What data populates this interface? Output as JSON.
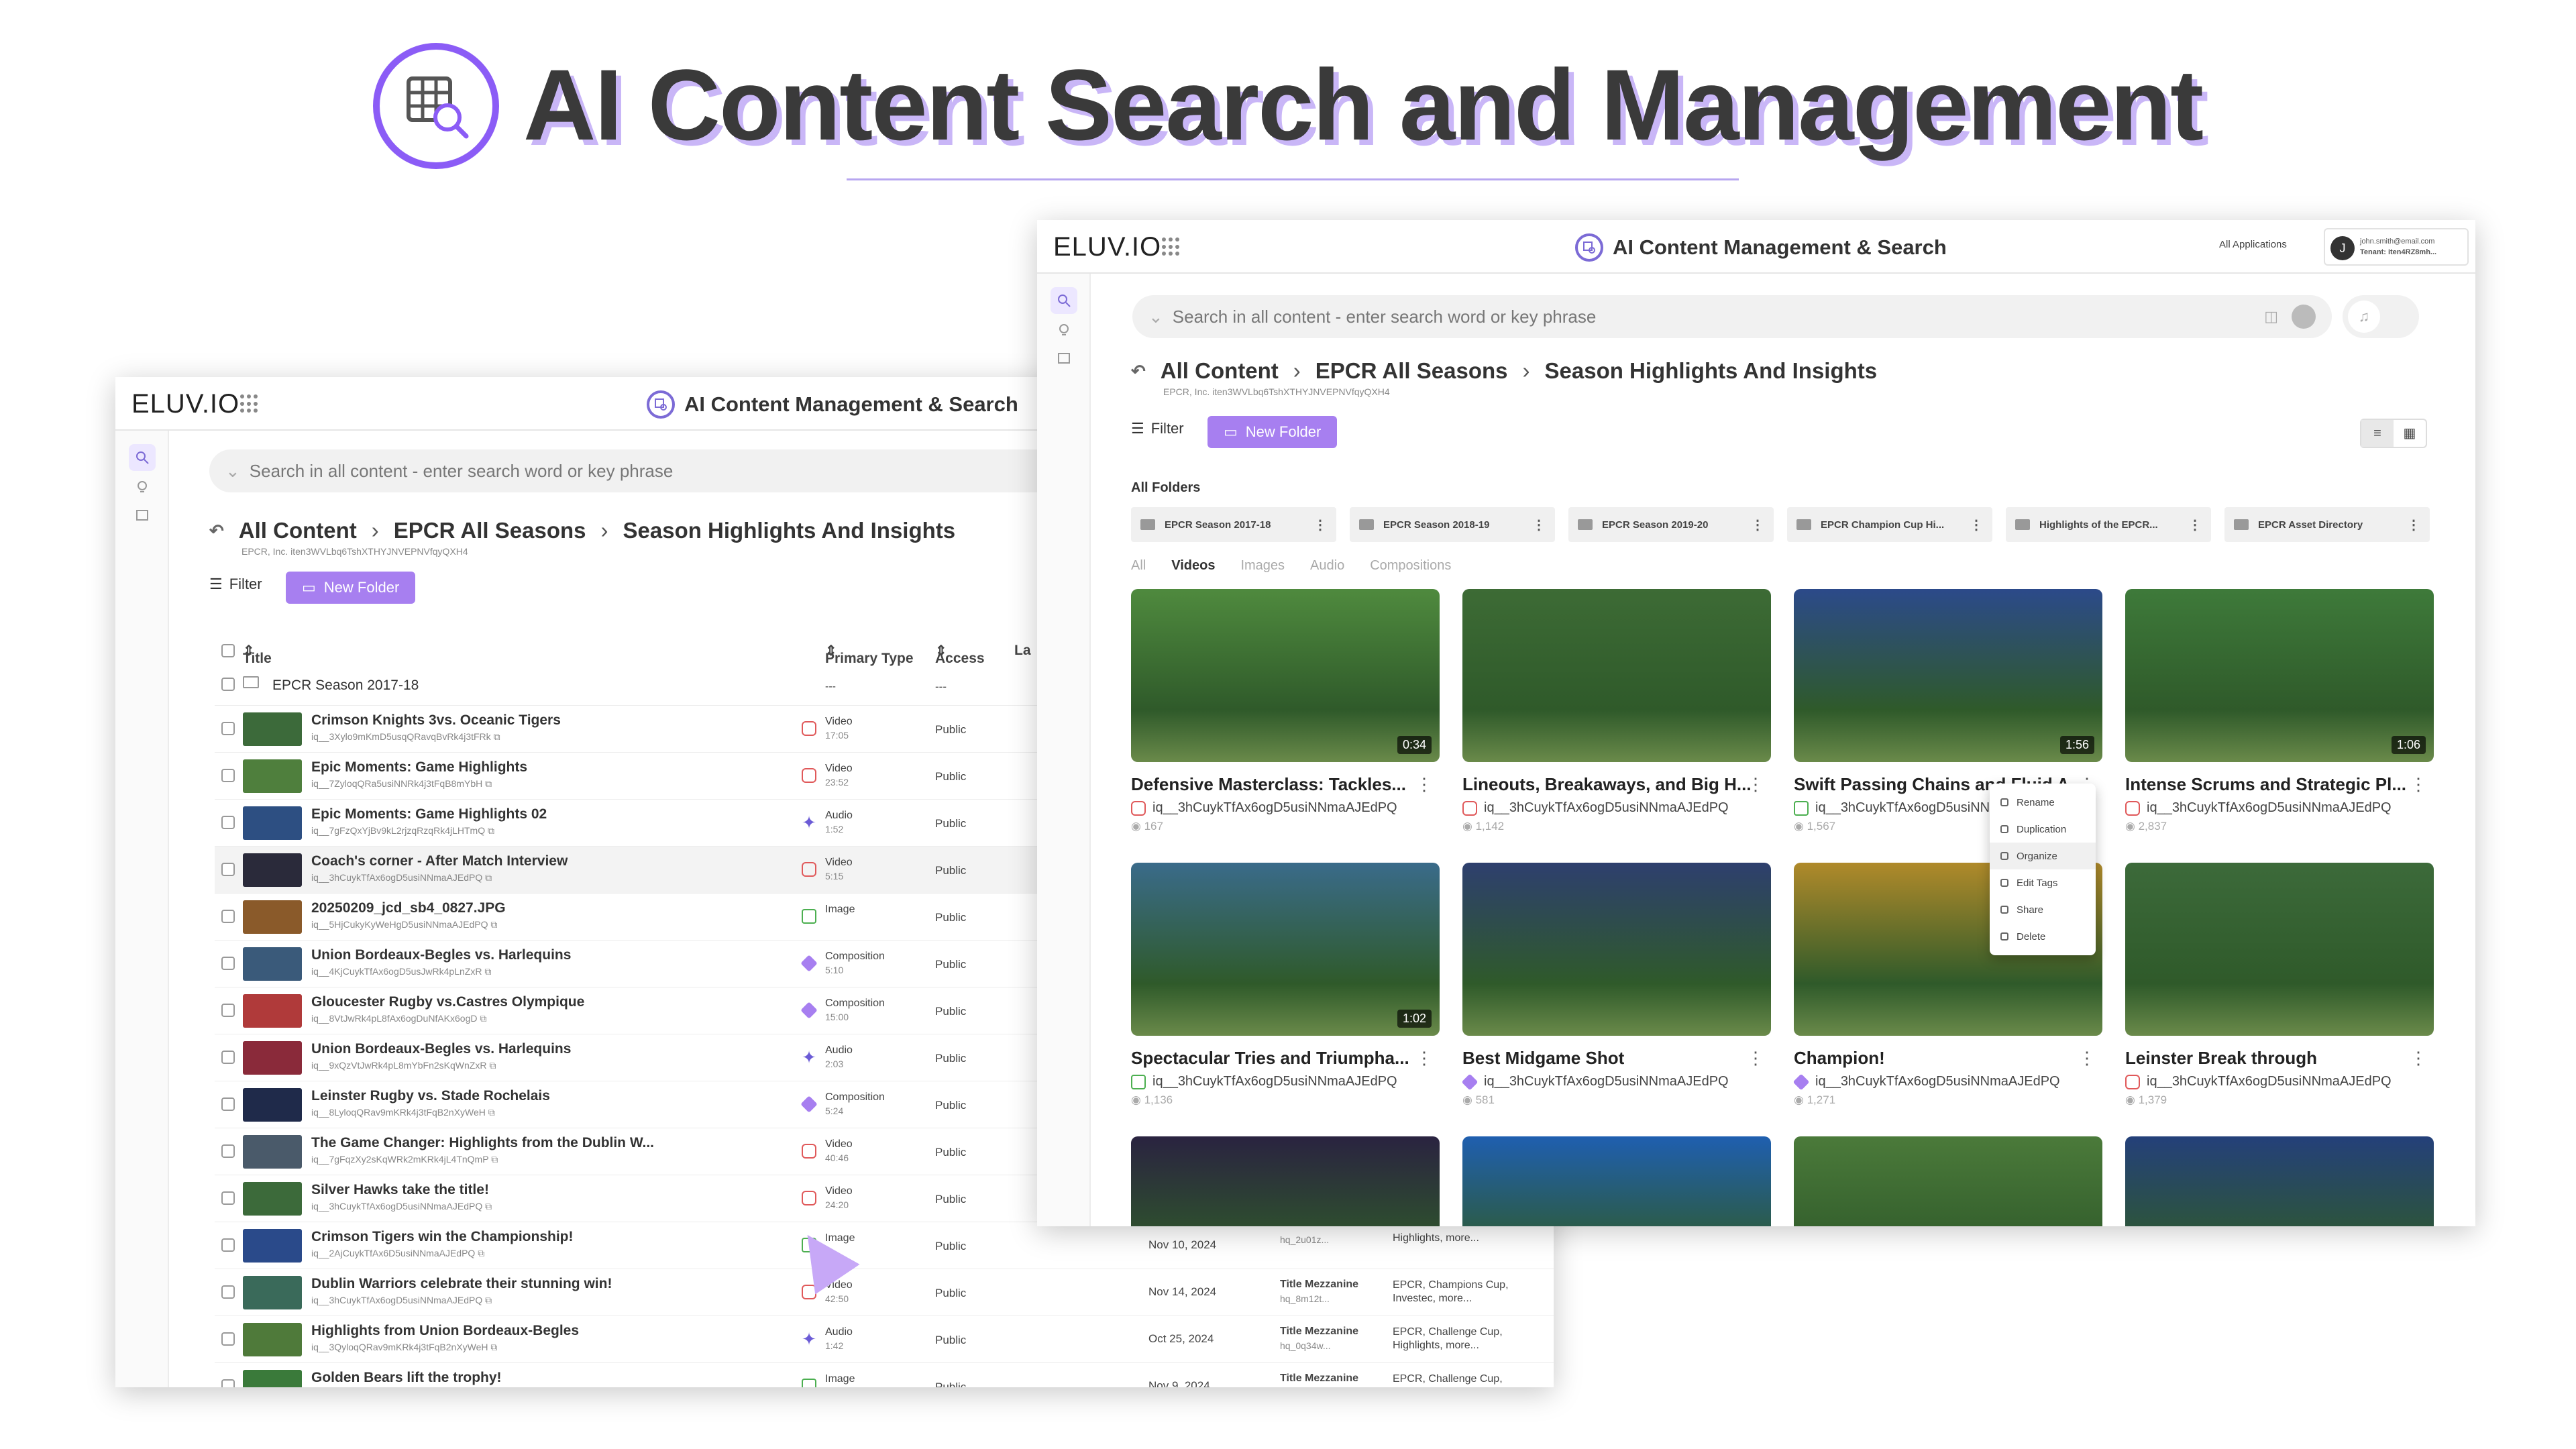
{
  "headline": {
    "title": "AI Content Search and Management"
  },
  "colors": {
    "accent": "#a77ff0",
    "brand_purple": "#8b5cf6"
  },
  "brand": "ELUV.IO",
  "app_title": "AI Content Management & Search",
  "header_right": {
    "all_applications": "All Applications",
    "avatar_initial": "J",
    "user_email": "john.smith@email.com",
    "tenant": "Tenant: iten4RZ8mh..."
  },
  "search": {
    "placeholder": "Search in all content - enter search word or key phrase"
  },
  "breadcrumb": {
    "items": [
      "All Content",
      "EPCR All Seasons",
      "Season Highlights And Insights"
    ],
    "sub": "EPCR, Inc.   iten3WVLbq6TshXTHYJNVEPNVfqyQXH4"
  },
  "toolbar": {
    "filter": "Filter",
    "new_folder": "New Folder"
  },
  "table": {
    "headers": {
      "title": "Title",
      "primary_type": "Primary Type",
      "access": "Access",
      "last": "La"
    },
    "folder_row": {
      "title": "EPCR Season 2017-18",
      "type": "---",
      "access": "---"
    },
    "rows": [
      {
        "title": "Crimson Knights 3vs. Oceanic Tigers",
        "id": "iq__3Xylo9mKmD5usqQRavqBvRk4j3tFRk",
        "type": "Video",
        "meta": "17:05",
        "access": "Public",
        "date": "",
        "fmt": "",
        "fmt_id": "",
        "tags": ""
      },
      {
        "title": "Epic Moments: Game Highlights",
        "id": "iq__7ZyloqQRa5usiNNRk4j3tFqB8mYbH",
        "type": "Video",
        "meta": "23:52",
        "access": "Public",
        "date": "",
        "fmt": "",
        "fmt_id": "",
        "tags": ""
      },
      {
        "title": "Epic Moments: Game Highlights 02",
        "id": "iq__7gFzQxYjBv9kL2rjzqRzqRk4jLHTmQ",
        "type": "Audio",
        "meta": "1:52",
        "access": "Public",
        "date": "",
        "fmt": "",
        "fmt_id": "",
        "tags": ""
      },
      {
        "title": "Coach's corner - After Match Interview",
        "id": "iq__3hCuykTfAx6ogD5usiNNmaAJEdPQ",
        "type": "Video",
        "meta": "5:15",
        "access": "Public",
        "date": "",
        "fmt": "",
        "fmt_id": "",
        "tags": ""
      },
      {
        "title": "20250209_jcd_sb4_0827.JPG",
        "id": "iq__5HjCukyKyWeHgD5usiNNmaAJEdPQ",
        "type": "Image",
        "meta": "",
        "access": "Public",
        "date": "",
        "fmt": "",
        "fmt_id": "",
        "tags": ""
      },
      {
        "title": "Union Bordeaux-Begles vs. Harlequins",
        "id": "iq__4KjCuykTfAx6ogD5usJwRk4pLnZxR",
        "type": "Composition",
        "meta": "5:10",
        "access": "Public",
        "date": "",
        "fmt": "",
        "fmt_id": "",
        "tags": ""
      },
      {
        "title": "Gloucester Rugby vs.Castres Olympique",
        "id": "iq__8VtJwRk4pL8fAx6ogDuNfAKx6ogD",
        "type": "Composition",
        "meta": "15:00",
        "access": "Public",
        "date": "",
        "fmt": "",
        "fmt_id": "",
        "tags": ""
      },
      {
        "title": "Union Bordeaux-Begles vs. Harlequins",
        "id": "iq__9xQzVtJwRk4pL8mYbFn2sKqWnZxR",
        "type": "Audio",
        "meta": "2:03",
        "access": "Public",
        "date": "",
        "fmt": "",
        "fmt_id": "",
        "tags": ""
      },
      {
        "title": "Leinster Rugby vs. Stade Rochelais",
        "id": "iq__8LyloqQRav9mKRk4j3tFqB2nXyWeH",
        "type": "Composition",
        "meta": "5:24",
        "access": "Public",
        "date": "",
        "fmt": "",
        "fmt_id": "",
        "tags": ""
      },
      {
        "title": "The Game Changer: Highlights from the Dublin W...",
        "id": "iq__7gFqzXy2sKqWRk2mKRk4jL4TnQmP",
        "type": "Video",
        "meta": "40:46",
        "access": "Public",
        "date": "",
        "fmt": "",
        "fmt_id": "",
        "tags": ""
      },
      {
        "title": "Silver Hawks take the title!",
        "id": "iq__3hCuykTfAx6ogD5usiNNmaAJEdPQ",
        "type": "Video",
        "meta": "24:20",
        "access": "Public",
        "date": "",
        "fmt": "",
        "fmt_id": "",
        "tags": ""
      },
      {
        "title": "Crimson Tigers win the Championship!",
        "id": "iq__2AjCuykTfAx6D5usiNNmaAJEdPQ",
        "type": "Image",
        "meta": "",
        "access": "Public",
        "date": "Nov 10, 2024",
        "fmt": "",
        "fmt_id": "hq_2u01z...",
        "tags": "Highlights, more..."
      },
      {
        "title": "Dublin Warriors celebrate their stunning win!",
        "id": "iq__3hCuykTfAx6ogD5usiNNmaAJEdPQ",
        "type": "Video",
        "meta": "42:50",
        "access": "Public",
        "date": "Nov 14, 2024",
        "fmt": "Title Mezzanine",
        "fmt_id": "hq_8m12t...",
        "tags": "EPCR, Champions Cup, Investec, more..."
      },
      {
        "title": "Highlights from Union Bordeaux-Begles",
        "id": "iq__3QyloqQRav9mKRk4j3tFqB2nXyWeH",
        "type": "Audio",
        "meta": "1:42",
        "access": "Public",
        "date": "Oct 25, 2024",
        "fmt": "Title Mezzanine",
        "fmt_id": "hq_0q34w...",
        "tags": "EPCR, Challenge Cup, Highlights, more..."
      },
      {
        "title": "Golden Bears lift the trophy!",
        "id": "iq__3hCuykTfAx6ogD5usiNNmaAJEdPQ",
        "type": "Image",
        "meta": "",
        "access": "Public",
        "date": "Nov 9, 2024",
        "fmt": "Title Mezzanine",
        "fmt_id": "hq_6p23v...",
        "tags": "EPCR, Challenge Cup, Season 2017-18, more..."
      }
    ]
  },
  "grid": {
    "folders_label": "All Folders",
    "folders": [
      "EPCR Season 2017-18",
      "EPCR Season 2018-19",
      "EPCR Season 2019-20",
      "EPCR Champion Cup Hi...",
      "Highlights of the EPCR...",
      "EPCR Asset Directory"
    ],
    "tabs": [
      "All",
      "Videos",
      "Images",
      "Audio",
      "Compositions"
    ],
    "active_tab": "Videos",
    "cards": [
      {
        "title": "Defensive Masterclass: Tackles...",
        "id": "iq__3hCuykTfAx6ogD5usiNNmaAJEdPQ",
        "views": "167",
        "duration": "0:34",
        "kind": "video",
        "color": "#4f8a3e"
      },
      {
        "title": "Lineouts, Breakaways, and Big H...",
        "id": "iq__3hCuykTfAx6ogD5usiNNmaAJEdPQ",
        "views": "1,142",
        "duration": "",
        "kind": "video",
        "color": "#3d6b35"
      },
      {
        "title": "Swift Passing Chains and Fluid A...",
        "id": "iq__3hCuykTfAx6ogD5usiNNmaAJEdPQ",
        "views": "1,567",
        "duration": "1:56",
        "kind": "image",
        "color": "#2c4a8a"
      },
      {
        "title": "Intense Scrums and Strategic Pl...",
        "id": "iq__3hCuykTfAx6ogD5usiNNmaAJEdPQ",
        "views": "2,837",
        "duration": "1:06",
        "kind": "video",
        "color": "#3e7a3a"
      },
      {
        "title": "Spectacular Tries and Triumpha...",
        "id": "iq__3hCuykTfAx6ogD5usiNNmaAJEdPQ",
        "views": "1,136",
        "duration": "1:02",
        "kind": "image",
        "color": "#3a6b8a"
      },
      {
        "title": "Best Midgame Shot",
        "id": "iq__3hCuykTfAx6ogD5usiNNmaAJEdPQ",
        "views": "581",
        "duration": "",
        "kind": "comp",
        "color": "#2e3f6e"
      },
      {
        "title": "Champion!",
        "id": "iq__3hCuykTfAx6ogD5usiNNmaAJEdPQ",
        "views": "1,271",
        "duration": "",
        "kind": "comp",
        "color": "#b08a2a"
      },
      {
        "title": "Leinster Break through",
        "id": "iq__3hCuykTfAx6ogD5usiNNmaAJEdPQ",
        "views": "1,379",
        "duration": "",
        "kind": "video",
        "color": "#3c6a3a"
      },
      {
        "title": "",
        "id": "",
        "views": "",
        "duration": "",
        "kind": "",
        "color": "#2a2340"
      },
      {
        "title": "",
        "id": "",
        "views": "",
        "duration": "",
        "kind": "",
        "color": "#1f5fb0"
      },
      {
        "title": "",
        "id": "",
        "views": "",
        "duration": "",
        "kind": "",
        "color": "#4b7a3a"
      },
      {
        "title": "",
        "id": "",
        "views": "",
        "duration": "",
        "kind": "",
        "color": "#24407a"
      }
    ],
    "context_menu": [
      "Rename",
      "Duplication",
      "Organize",
      "Edit Tags",
      "Share",
      "Delete"
    ],
    "context_selected": "Organize"
  }
}
